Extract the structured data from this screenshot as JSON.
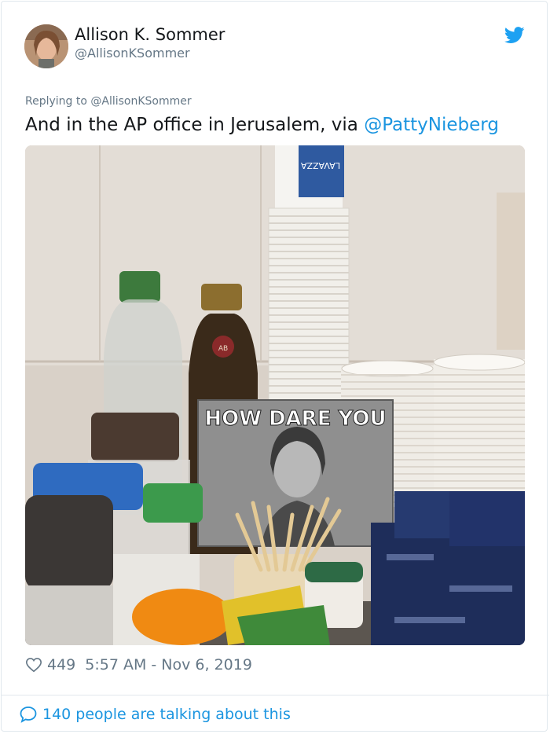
{
  "author": {
    "name": "Allison K. Sommer",
    "handle": "@AllisonKSommer"
  },
  "tweet": {
    "replying_prefix": "Replying to ",
    "replying_to": "@AllisonKSommer",
    "text": "And in the AP office in Jerusalem, via ",
    "mention": "@PattyNieberg"
  },
  "photo": {
    "meme_caption": "HOW DARE YOU",
    "cup_brand": "LAVAZZA",
    "bottle_label": "AB"
  },
  "stats": {
    "likes": "449",
    "timestamp": "5:57 AM - Nov 6, 2019"
  },
  "footer": {
    "talking": "140 people are talking about this"
  },
  "colors": {
    "accent": "#1b95e0",
    "muted": "#657786",
    "text": "#14171a",
    "border": "#e1e8ed"
  },
  "icons": [
    "heart-icon",
    "twitter-bird-icon",
    "speech-bubble-icon"
  ]
}
